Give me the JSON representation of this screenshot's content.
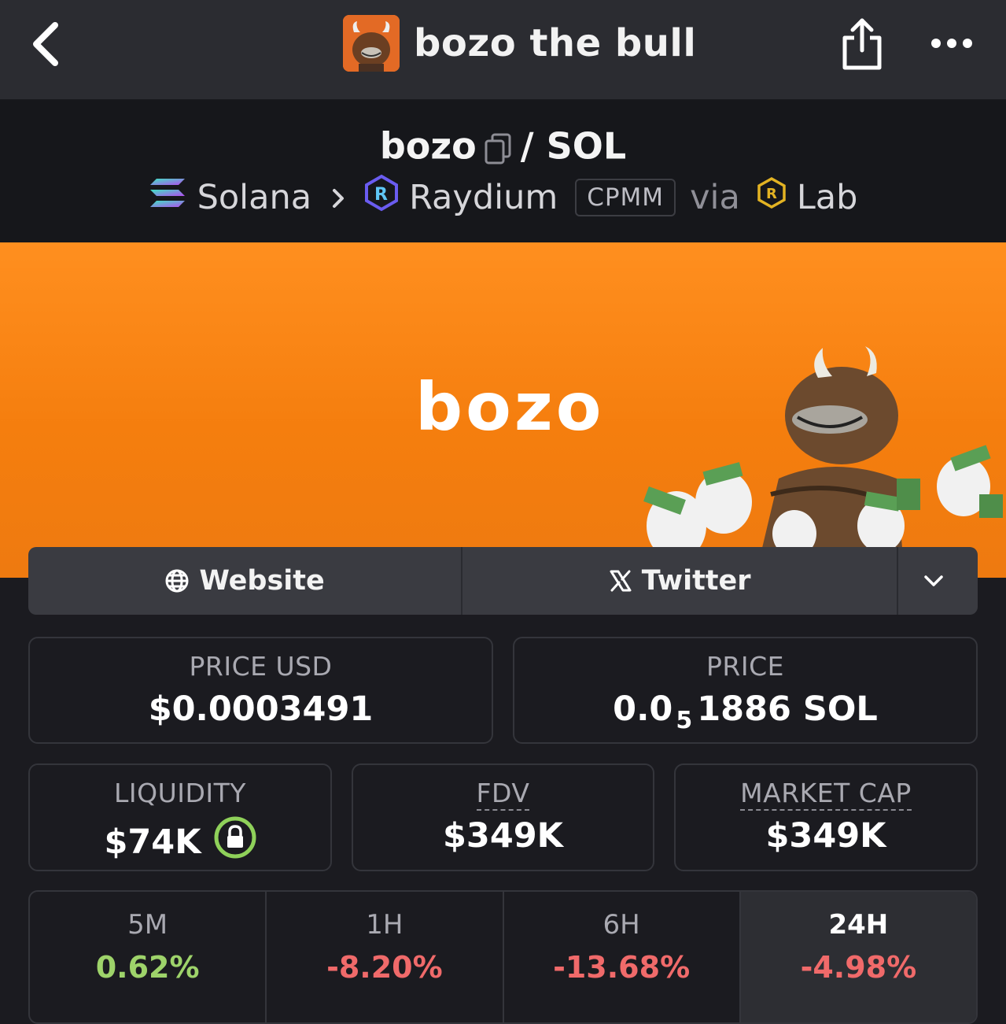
{
  "header": {
    "title": "bozo the bull",
    "back_icon": "chevron-left-icon",
    "share_icon": "share-icon",
    "more_icon": "more-horizontal-icon"
  },
  "pair": {
    "base": "bozo",
    "separator": "/",
    "quote": "SOL",
    "chain": "Solana",
    "dex": "Raydium",
    "pool_type": "CPMM",
    "via_label": "via",
    "launchpad": "Lab"
  },
  "banner": {
    "text": "bozo",
    "background_color": "#f58318"
  },
  "links": {
    "website_label": "Website",
    "twitter_label": "Twitter"
  },
  "stats": {
    "price_usd_label": "PRICE USD",
    "price_usd_value": "$0.0003491",
    "price_label": "PRICE",
    "price_prefix": "0.0",
    "price_subscript": "5",
    "price_suffix": "1886 SOL",
    "liquidity_label": "LIQUIDITY",
    "liquidity_value": "$74K",
    "fdv_label": "FDV",
    "fdv_value": "$349K",
    "mcap_label": "MARKET CAP",
    "mcap_value": "$349K"
  },
  "changes": [
    {
      "label": "5M",
      "value": "0.62%",
      "direction": "up"
    },
    {
      "label": "1H",
      "value": "-8.20%",
      "direction": "down"
    },
    {
      "label": "6H",
      "value": "-13.68%",
      "direction": "down"
    },
    {
      "label": "24H",
      "value": "-4.98%",
      "direction": "down",
      "selected": true
    }
  ],
  "colors": {
    "positive": "#9ed36a",
    "negative": "#f06a6a",
    "locked": "#8fd15a"
  }
}
